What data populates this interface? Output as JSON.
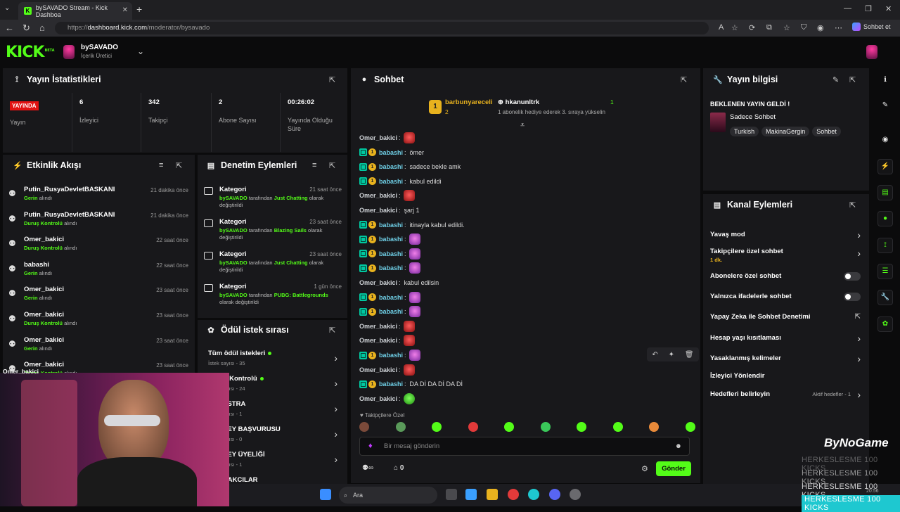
{
  "browser": {
    "tab_title": "bySAVADO Stream - Kick Dashboa",
    "url_prefix": "https://",
    "url_domain": "dashboard.kick.com",
    "url_path": "/moderator/bysavado",
    "copilot_label": "Sohbet et"
  },
  "header": {
    "logo": "KICK",
    "logo_beta": "BETA",
    "channel_name": "bySAVADO",
    "channel_role": "İçerik Üretici"
  },
  "stats": {
    "title": "Yayın İstatistikleri",
    "live_badge": "YAYINDA",
    "live_label": "Yayın",
    "cells": [
      {
        "value": "6",
        "label": "İzleyici"
      },
      {
        "value": "342",
        "label": "Takipçi"
      },
      {
        "value": "2",
        "label": "Abone Sayısı"
      },
      {
        "value": "00:26:02",
        "label": "Yayında Olduğu Süre"
      }
    ]
  },
  "events": {
    "title": "Etkinlik Akışı",
    "items": [
      {
        "name": "Putin_RusyaDevletBASKANI",
        "time": "21 dakika önce",
        "action": "Gerin",
        "suffix": " alındı"
      },
      {
        "name": "Putin_RusyaDevletBASKANI",
        "time": "21 dakika önce",
        "action": "Duruş Kontrolü",
        "suffix": " alındı"
      },
      {
        "name": "Omer_bakici",
        "time": "22 saat önce",
        "action": "Duruş Kontrolü",
        "suffix": " alındı"
      },
      {
        "name": "babashi",
        "time": "22 saat önce",
        "action": "Gerin",
        "suffix": " alındı"
      },
      {
        "name": "Omer_bakici",
        "time": "23 saat önce",
        "action": "Gerin",
        "suffix": " alındı"
      },
      {
        "name": "Omer_bakici",
        "time": "23 saat önce",
        "action": "Duruş Kontrolü",
        "suffix": " alındı"
      },
      {
        "name": "Omer_bakici",
        "time": "23 saat önce",
        "action": "Gerin",
        "suffix": " alındı"
      },
      {
        "name": "Omer_bakici",
        "time": "23 saat önce",
        "action": "Duruş Kontrolü",
        "suffix": " alındı"
      }
    ]
  },
  "moderation": {
    "title": "Denetim Eylemleri",
    "items": [
      {
        "title": "Kategori",
        "time": "21 saat önce",
        "by": "bySAVADO",
        "mid": " tarafından ",
        "value": "Just Chatting",
        "tail": " olarak değiştirildi"
      },
      {
        "title": "Kategori",
        "time": "23 saat önce",
        "by": "bySAVADO",
        "mid": " tarafından ",
        "value": "Blazing Sails",
        "tail": " olarak değiştirildi"
      },
      {
        "title": "Kategori",
        "time": "23 saat önce",
        "by": "bySAVADO",
        "mid": " tarafından ",
        "value": "Just Chatting",
        "tail": " olarak değiştirildi"
      },
      {
        "title": "Kategori",
        "time": "1 gün önce",
        "by": "bySAVADO",
        "mid": " tarafından ",
        "value": "PUBG: Battlegrounds",
        "tail": " olarak değiştirildi"
      }
    ]
  },
  "rewards": {
    "title": "Ödül istek sırası",
    "items": [
      {
        "title": "Tüm ödül istekleri",
        "sub": "İstek sayısı - 35"
      },
      {
        "title": "Duruş Kontrolü",
        "sub": "İstek sayısı - 24"
      },
      {
        "title": "ORKESTRA",
        "sub": "İstek sayısı - 1"
      },
      {
        "title": "KONSEY BAŞVURUSU",
        "sub": "İstek sayısı - 0"
      },
      {
        "title": "KONSEY ÜYELİĞİ",
        "sub": "İstek sayısı - 1"
      },
      {
        "title": "TAPINAKCILAR",
        "sub": ""
      }
    ]
  },
  "chat": {
    "title": "Sohbet",
    "pinned_user1": "barbunyareceli",
    "pinned_count1": "2",
    "pinned_user2": "hkanunltrk",
    "pinned_count2": "1",
    "pinned_text": "1 abonelik hediye ederek 3. sıraya yükselin",
    "messages": [
      {
        "user": "Omer_bakici",
        "kind": "omer",
        "text": "",
        "emote": "red"
      },
      {
        "user": "babashi",
        "kind": "baba",
        "text": "ömer",
        "emote": ""
      },
      {
        "user": "babashi",
        "kind": "baba",
        "text": "sadece bekle amk",
        "emote": ""
      },
      {
        "user": "babashi",
        "kind": "baba",
        "text": "kabul edildi",
        "emote": ""
      },
      {
        "user": "Omer_bakici",
        "kind": "omer",
        "text": "",
        "emote": "red"
      },
      {
        "user": "Omer_bakici",
        "kind": "omer",
        "text": "şarj 1",
        "emote": ""
      },
      {
        "user": "babashi",
        "kind": "baba",
        "text": "itinayla kabul edildi.",
        "emote": ""
      },
      {
        "user": "babashi",
        "kind": "baba",
        "text": "",
        "emote": "pink"
      },
      {
        "user": "babashi",
        "kind": "baba",
        "text": "",
        "emote": "pink"
      },
      {
        "user": "babashi",
        "kind": "baba",
        "text": "",
        "emote": "pink"
      },
      {
        "user": "Omer_bakici",
        "kind": "omer",
        "text": "kabul edilsin",
        "emote": ""
      },
      {
        "user": "babashi",
        "kind": "baba",
        "text": "",
        "emote": "pink"
      },
      {
        "user": "babashi",
        "kind": "baba",
        "text": "",
        "emote": "pink"
      },
      {
        "user": "Omer_bakici",
        "kind": "omer",
        "text": "",
        "emote": "red"
      },
      {
        "user": "Omer_bakici",
        "kind": "omer",
        "text": "",
        "emote": "red"
      },
      {
        "user": "babashi",
        "kind": "baba",
        "text": "",
        "emote": "pink"
      },
      {
        "user": "Omer_bakici",
        "kind": "omer",
        "text": "",
        "emote": "red"
      },
      {
        "user": "babashi",
        "kind": "baba",
        "text": "DA Dİ DA Dİ DA Dİ",
        "emote": ""
      },
      {
        "user": "Omer_bakici",
        "kind": "omer",
        "text": "",
        "emote": "green"
      }
    ],
    "followers_only_label": "Takipçilere Özel",
    "input_placeholder": "Bir mesaj gönderin",
    "points": "0",
    "send_label": "Gönder"
  },
  "stream_info": {
    "title": "Yayın bilgisi",
    "stream_title": "BEKLENEN YAYIN GELDİ !",
    "category": "Sadece Sohbet",
    "tags": [
      "Turkish",
      "MakinaGergin",
      "Sohbet"
    ]
  },
  "channel_actions": {
    "title": "Kanal Eylemleri",
    "items": [
      {
        "label": "Yavaş mod",
        "sub": "",
        "control": "arrow"
      },
      {
        "label": "Takipçilere özel sohbet",
        "sub": "1 dk.",
        "control": "arrow"
      },
      {
        "label": "Abonelere özel sohbet",
        "sub": "",
        "control": "toggle"
      },
      {
        "label": "Yalnızca ifadelerle sohbet",
        "sub": "",
        "control": "toggle"
      },
      {
        "label": "Yapay Zeka ile Sohbet Denetimi",
        "sub": "",
        "control": "external"
      },
      {
        "label": "Hesap yaşı kısıtlaması",
        "sub": "",
        "control": "arrow"
      },
      {
        "label": "Yasaklanmış kelimeler",
        "sub": "",
        "control": "arrow"
      },
      {
        "label": "İzleyici Yönlendir",
        "sub": "",
        "control": "none"
      },
      {
        "label": "Hedefleri belirleyin",
        "sub": "",
        "control": "arrow"
      }
    ],
    "goals_status": "Aktif hedefler - 1"
  },
  "overlay": {
    "webcam_name": "Omer_bakici",
    "brand": "ByNoGame",
    "ticker": [
      "HERKESLESME   100 KICKS",
      "HERKESLESME   100 KICKS",
      "HERKESLESME   100 KICKS",
      "HERKESLESME   100 KICKS"
    ],
    "taskbar_search": "Ara",
    "clock": "20:56"
  }
}
